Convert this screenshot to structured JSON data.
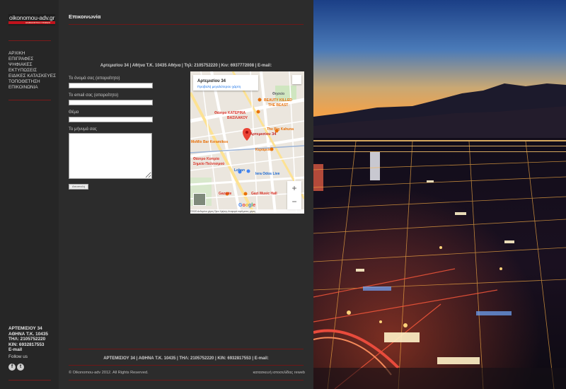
{
  "brand": {
    "name": "oikonomou-adv.gr",
    "tagline": "ΔΙΑΦΗΜΙΣΤΙΚΟ ΓΡΑΦΕΙΟ"
  },
  "nav": {
    "items": [
      {
        "label": "ΑΡΧΙΚΗ"
      },
      {
        "label": "ΕΠΙΓΡΑΦΕΣ"
      },
      {
        "label": "ΨΗΦΙΑΚΕΣ"
      },
      {
        "label": "ΕΚΤΥΠΩΣΕΙΣ"
      },
      {
        "label": "ΕΙΔΙΚΕΣ ΚΑΤΑΣΚΕΥΕΣ"
      },
      {
        "label": "ΤΟΠΟΘΕΤΗΣΗ"
      },
      {
        "label": "ΕΠΙΚΟΙΝΩΝΙΑ"
      }
    ]
  },
  "sidebar_address": {
    "line1": "ΑΡΤΕΜΙΣΙΟΥ 34",
    "line2": "ΑΘΗΝΑ Τ.Κ. 10435",
    "line3": "ΤΗΛ: 2105752220",
    "line4": "ΚΙΝ: 6932817553",
    "line5": "E-mail"
  },
  "social": {
    "label": "Follow us",
    "facebook": "f",
    "twitter": "t"
  },
  "page": {
    "title": "Επικοινωνία",
    "contact_line": "Αρτεμισίου 34 | Αθήνα Τ.Κ. 10435  Αθήνα | Τηλ: 2105752220 | Κιν: 6937772008 | E-mail:"
  },
  "form": {
    "name_label": "Το όνομά σας (απαραίτητο)",
    "email_label": "Το email σας (απαραίτητο)",
    "subject_label": "Θέμα",
    "message_label": "Το μήνυμά σας",
    "send_label": "Αποστολή"
  },
  "map": {
    "place_title": "Αρτεμισίου 34",
    "place_link": "Προβολή μεγαλύτερου χάρτη",
    "marker_label": "Αρτεμισίου 34",
    "pois": {
      "beauty": "BEAUTY KILLED",
      "beauty2": "THE BEAST",
      "theater": "Θέατρο ΚΑΤΕΡΙΝΑ",
      "theater2": "ΒΑΣΙΛΑΚΟΥ",
      "kahuna": "The Big Kahuna",
      "mix": "MoMix Bar Keramikos",
      "keramio": "Κεραμείο",
      "cyprus": "Θέατρο Κυπρία",
      "cyprus2": "Σημείο Πολιτισμού",
      "iera": "Iera Odos Live",
      "gazi": "Gazi Music Hall",
      "gazarte": "Gazarte",
      "lohan": "Lohan",
      "thiseio": "Θησείο"
    },
    "google": "Google",
    "zoom_in": "+",
    "zoom_out": "−",
    "footer": "©2020 Δεδομένα χάρτη   Όροι Χρήσης   Αναφορά σφάλματος χάρτη"
  },
  "footer": {
    "address_line": "ΑΡΤΕΜΙΣΙΟΥ 34 | ΑΘΗΝΑ Τ.Κ. 10435 | ΤΗΛ: 2105752220 | ΚΙΝ: 6932817553 | E-mail:",
    "copyright": "© Oikonomou-adv 2012. All Rights Reserved.",
    "credits": "κατασκευή ιστοσελίδας reweb"
  },
  "colors": {
    "accent_red": "#c1121c",
    "sidebar_bg": "#262626",
    "content_bg": "#2c2c2c"
  }
}
